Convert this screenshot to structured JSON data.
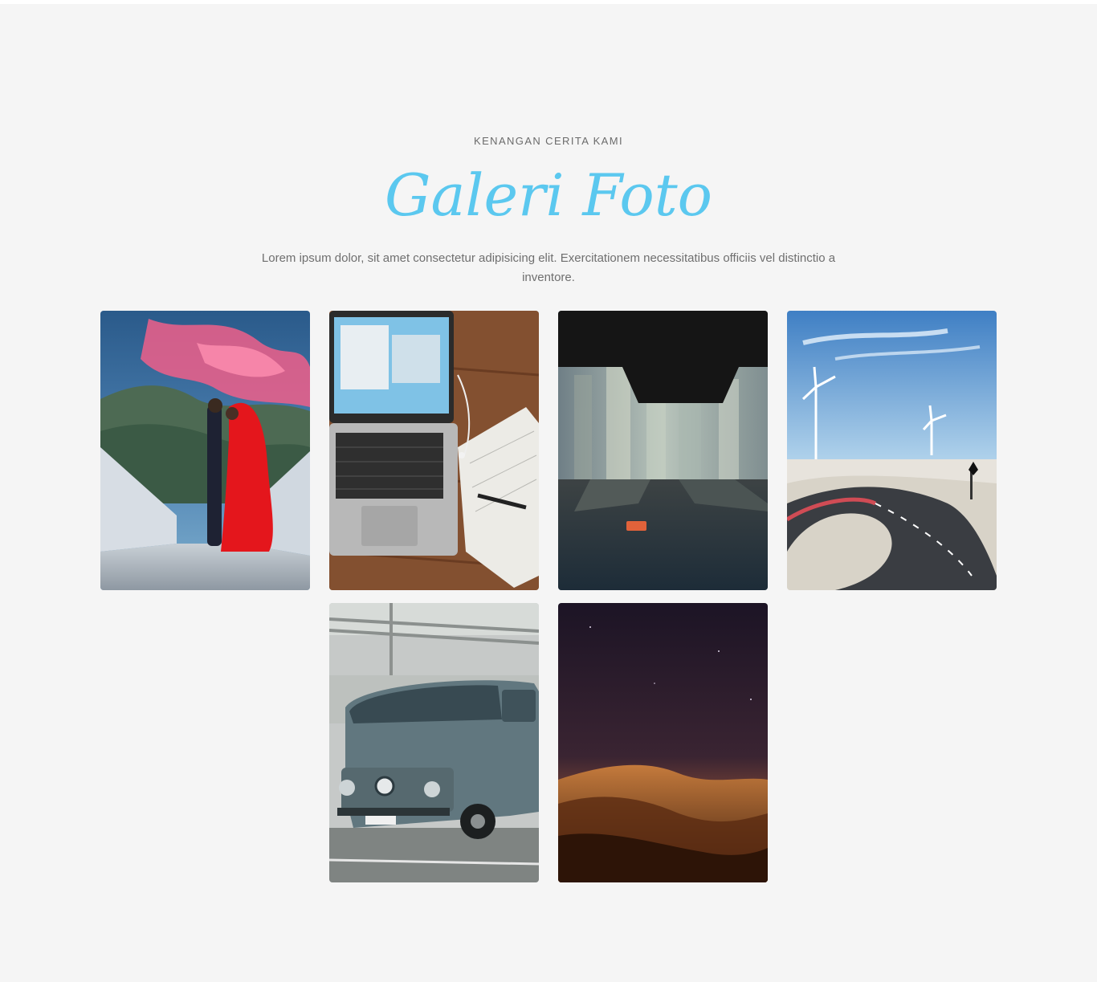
{
  "section": {
    "eyebrow": "KENANGAN CERITA KAMI",
    "title": "Galeri Foto",
    "description": "Lorem ipsum dolor, sit amet consectetur adipisicing elit. Exercitationem necessitatibus officiis vel distinctio a inventore.",
    "accent_color": "#5bc8ef",
    "background_color": "#f5f5f5"
  }
}
